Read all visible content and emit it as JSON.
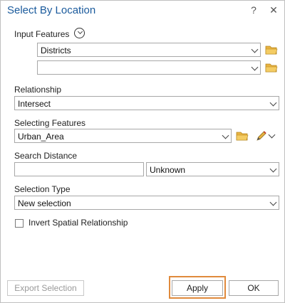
{
  "dialog": {
    "title": "Select By Location",
    "help_label": "?",
    "close_label": "✕"
  },
  "input_features": {
    "label": "Input Features",
    "items": [
      "Districts",
      ""
    ]
  },
  "relationship": {
    "label": "Relationship",
    "value": "Intersect"
  },
  "selecting_features": {
    "label": "Selecting Features",
    "value": "Urban_Area"
  },
  "search_distance": {
    "label": "Search Distance",
    "value": "",
    "unit": "Unknown"
  },
  "selection_type": {
    "label": "Selection Type",
    "value": "New selection"
  },
  "invert": {
    "label": "Invert Spatial Relationship",
    "checked": false
  },
  "footer": {
    "export_label": "Export Selection",
    "apply_label": "Apply",
    "ok_label": "OK"
  },
  "colors": {
    "title": "#1a5a9c",
    "folder": "#e8b341",
    "highlight": "#e08a3c"
  },
  "icons": [
    "help-icon",
    "close-icon",
    "chevron-down-icon",
    "folder-icon",
    "pencil-icon"
  ]
}
